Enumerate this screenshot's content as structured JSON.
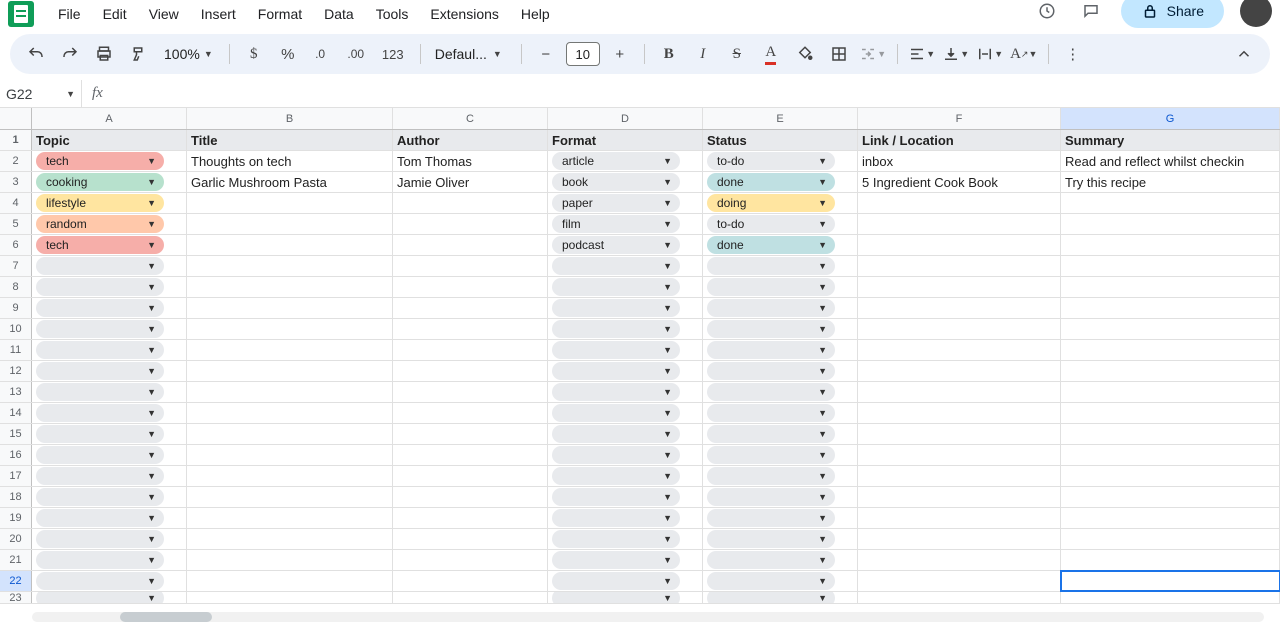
{
  "menu": {
    "items": [
      "File",
      "Edit",
      "View",
      "Insert",
      "Format",
      "Data",
      "Tools",
      "Extensions",
      "Help"
    ]
  },
  "share": {
    "label": "Share"
  },
  "toolbar": {
    "zoom": "100%",
    "font": "Defaul...",
    "fontsize": "10",
    "format123": "123"
  },
  "namebox": "G22",
  "columns": [
    "A",
    "B",
    "C",
    "D",
    "E",
    "F",
    "G"
  ],
  "headers": {
    "A": "Topic",
    "B": "Title",
    "C": "Author",
    "D": "Format",
    "E": "Status",
    "F": "Link / Location",
    "G": "Summary"
  },
  "rows": [
    {
      "topic": {
        "v": "tech",
        "cls": "chip-tech"
      },
      "title": "Thoughts on tech",
      "author": "Tom Thomas",
      "format": {
        "v": "article",
        "cls": "chip-empty"
      },
      "status": {
        "v": "to-do",
        "cls": "chip-todo"
      },
      "link": "inbox",
      "summary": "Read and reflect whilst checkin"
    },
    {
      "topic": {
        "v": "cooking",
        "cls": "chip-cooking"
      },
      "title": "Garlic Mushroom Pasta",
      "author": "Jamie Oliver",
      "format": {
        "v": "book",
        "cls": "chip-empty"
      },
      "status": {
        "v": "done",
        "cls": "chip-done"
      },
      "link": "5 Ingredient Cook Book",
      "summary": "Try this recipe"
    },
    {
      "topic": {
        "v": "lifestyle",
        "cls": "chip-lifestyle"
      },
      "title": "",
      "author": "",
      "format": {
        "v": "paper",
        "cls": "chip-empty"
      },
      "status": {
        "v": "doing",
        "cls": "chip-doing"
      },
      "link": "",
      "summary": ""
    },
    {
      "topic": {
        "v": "random",
        "cls": "chip-random"
      },
      "title": "",
      "author": "",
      "format": {
        "v": "film",
        "cls": "chip-empty"
      },
      "status": {
        "v": "to-do",
        "cls": "chip-todo"
      },
      "link": "",
      "summary": ""
    },
    {
      "topic": {
        "v": "tech",
        "cls": "chip-tech"
      },
      "title": "",
      "author": "",
      "format": {
        "v": "podcast",
        "cls": "chip-empty"
      },
      "status": {
        "v": "done",
        "cls": "chip-done"
      },
      "link": "",
      "summary": ""
    }
  ],
  "empty_rows": 18,
  "selected_row": 22,
  "selected_col": "G"
}
